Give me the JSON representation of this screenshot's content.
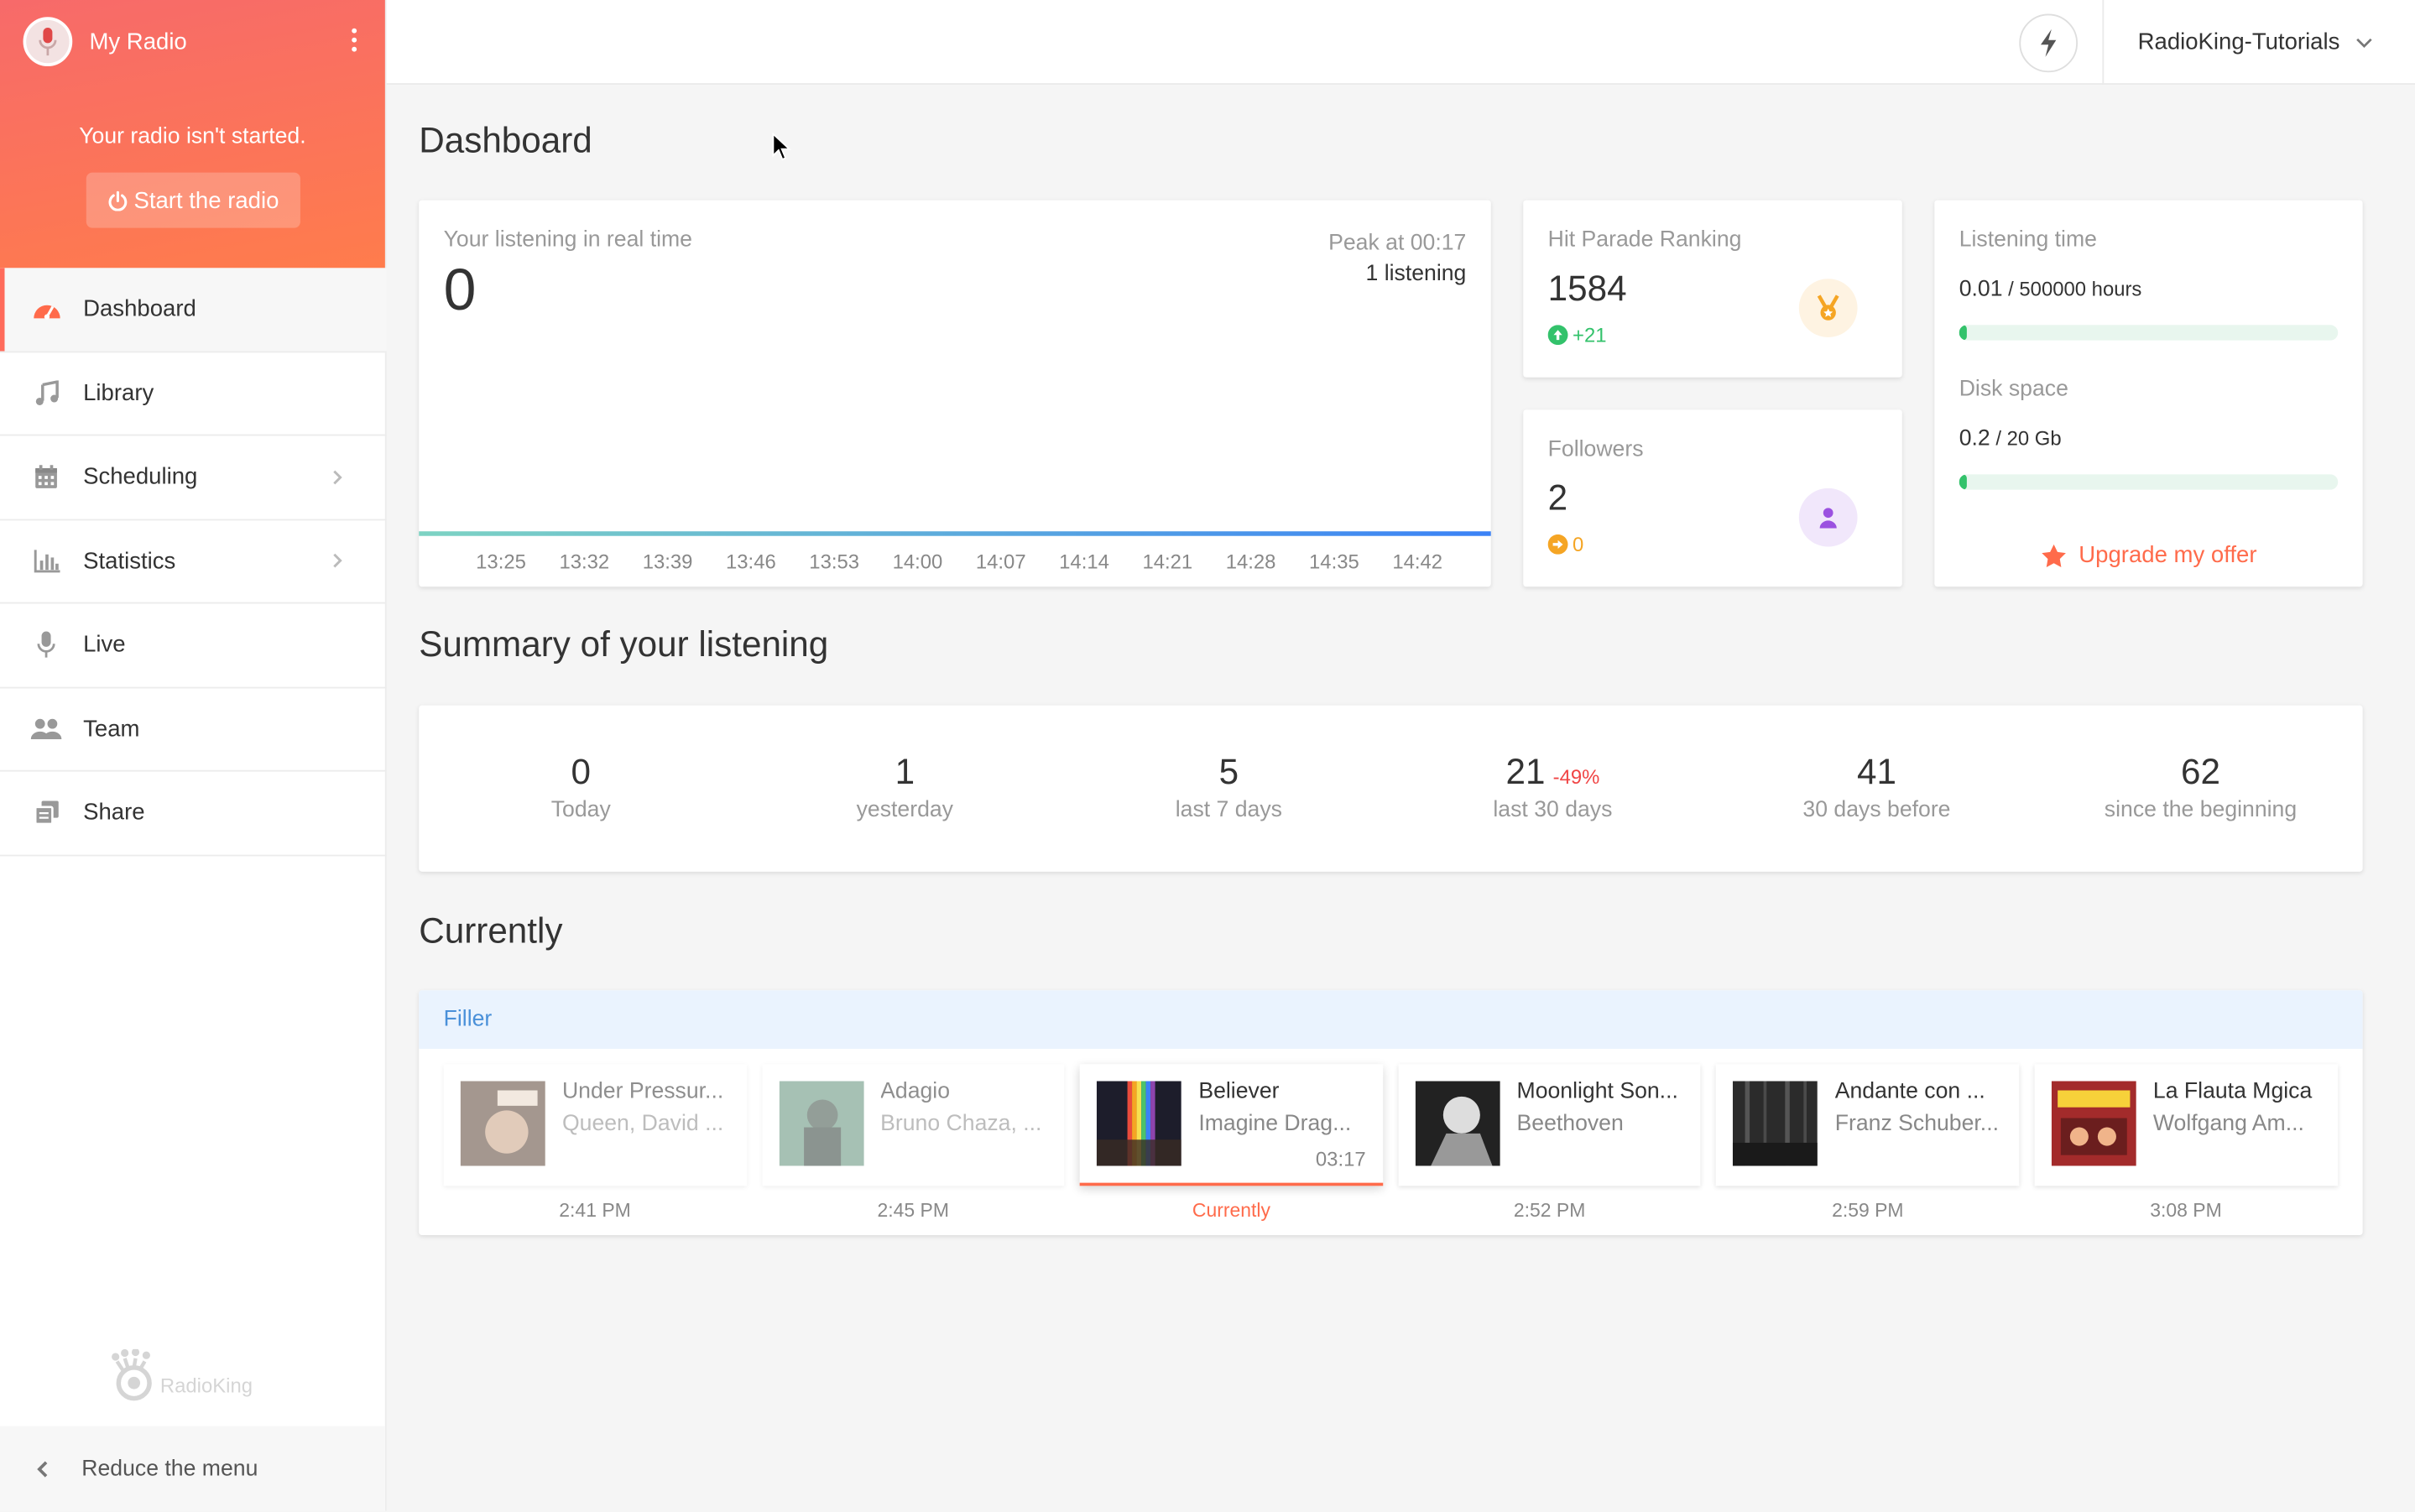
{
  "sidebar": {
    "radio_name": "My Radio",
    "status_text": "Your radio isn't started.",
    "start_button": "Start the radio",
    "items": [
      {
        "label": "Dashboard",
        "icon": "gauge-icon",
        "active": true
      },
      {
        "label": "Library",
        "icon": "music-note-icon"
      },
      {
        "label": "Scheduling",
        "icon": "calendar-icon",
        "has_submenu": true
      },
      {
        "label": "Statistics",
        "icon": "bar-chart-icon",
        "has_submenu": true
      },
      {
        "label": "Live",
        "icon": "microphone-icon"
      },
      {
        "label": "Team",
        "icon": "users-icon"
      },
      {
        "label": "Share",
        "icon": "share-icon"
      }
    ],
    "brand": "RadioKing",
    "reduce_label": "Reduce the menu"
  },
  "topbar": {
    "account_name": "RadioKing-Tutorials"
  },
  "dashboard": {
    "title": "Dashboard",
    "realtime": {
      "label": "Your listening in real time",
      "value": "0",
      "peak_label": "Peak at 00:17",
      "peak_value": "1 listening",
      "ticks": [
        "13:25",
        "13:32",
        "13:39",
        "13:46",
        "13:53",
        "14:00",
        "14:07",
        "14:14",
        "14:21",
        "14:28",
        "14:35",
        "14:42"
      ]
    },
    "hit_parade": {
      "label": "Hit Parade Ranking",
      "value": "1584",
      "delta": "+21",
      "icon": "medal-icon"
    },
    "followers": {
      "label": "Followers",
      "value": "2",
      "delta": "0",
      "icon": "user-icon"
    },
    "usage": {
      "listening_label": "Listening time",
      "listening_value": "0.01",
      "listening_total": " / 500000 hours",
      "listening_fraction": 2e-08,
      "disk_label": "Disk space",
      "disk_value": "0.2",
      "disk_total": " / 20 Gb",
      "disk_fraction": 0.01,
      "upgrade_label": "Upgrade my offer"
    }
  },
  "summary": {
    "title": "Summary of your listening",
    "cells": [
      {
        "value": "0",
        "label": "Today"
      },
      {
        "value": "1",
        "label": "yesterday"
      },
      {
        "value": "5",
        "label": "last 7 days"
      },
      {
        "value": "21",
        "label": "last 30 days",
        "change": "-49%"
      },
      {
        "value": "41",
        "label": "30 days before"
      },
      {
        "value": "62",
        "label": "since the beginning"
      }
    ]
  },
  "currently": {
    "title": "Currently",
    "playlist": "Filler",
    "tracks": [
      {
        "title": "Under Pressur...",
        "artist": "Queen, David ...",
        "time": "2:41 PM",
        "state": "past"
      },
      {
        "title": "Adagio",
        "artist": "Bruno Chaza, ...",
        "time": "2:45 PM",
        "state": "past"
      },
      {
        "title": "Believer",
        "artist": "Imagine Drag...",
        "duration": "03:17",
        "time": "Currently",
        "state": "current"
      },
      {
        "title": "Moonlight Son...",
        "artist": "Beethoven",
        "time": "2:52 PM",
        "state": "next"
      },
      {
        "title": "Andante con ...",
        "artist": "Franz Schuber...",
        "time": "2:59 PM",
        "state": "next"
      },
      {
        "title": "La Flauta Mgica",
        "artist": "Wolfgang Am...",
        "time": "3:08 PM",
        "state": "next"
      }
    ]
  },
  "colors": {
    "accent": "#ff6b4b",
    "header_gradient_start": "#f76a6a",
    "header_gradient_end": "#ff7c4c",
    "success": "#33c26b",
    "danger": "#f04545",
    "info": "#4a90d9"
  }
}
